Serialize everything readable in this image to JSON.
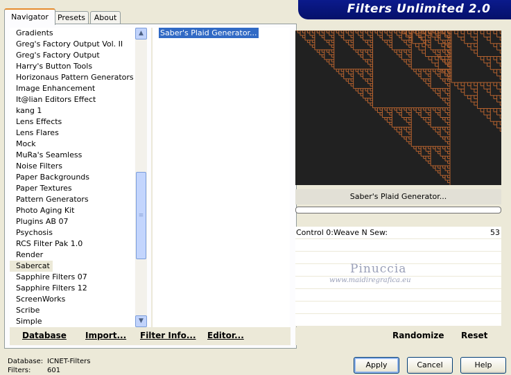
{
  "banner": {
    "title": "Filters Unlimited 2.0"
  },
  "tabs": [
    {
      "label": "Navigator",
      "active": true
    },
    {
      "label": "Presets",
      "active": false
    },
    {
      "label": "About",
      "active": false
    }
  ],
  "categories": [
    "Gradients",
    "Greg's Factory Output Vol. II",
    "Greg's Factory Output",
    "Harry's Button Tools",
    "Horizonaus Pattern Generators",
    "Image Enhancement",
    "It@lian Editors Effect",
    "kang 1",
    "Lens Effects",
    "Lens Flares",
    "Mock",
    "MuRa's Seamless",
    "Noise Filters",
    "Paper Backgrounds",
    "Paper Textures",
    "Pattern Generators",
    "Photo Aging Kit",
    "Plugins AB 07",
    "Psychosis",
    "RCS Filter Pak 1.0",
    "Render",
    "Sabercat",
    "Sapphire Filters 07",
    "Sapphire Filters 12",
    "ScreenWorks",
    "Scribe",
    "Simple"
  ],
  "selected_category": "Sabercat",
  "filters": [
    "Saber's Plaid Generator..."
  ],
  "nav_buttons": {
    "database": "Database",
    "import": "Import...",
    "filter_info": "Filter Info...",
    "editor": "Editor..."
  },
  "preview": {
    "filter_name": "Saber's Plaid Generator...",
    "background_color": "#212121",
    "pattern_color": "#b5622f"
  },
  "controls": [
    {
      "label": "Control 0:Weave N Sew:",
      "value": "53"
    }
  ],
  "watermark": {
    "line1": "Pinuccia",
    "line2": "www.maidiregrafica.eu"
  },
  "right_buttons": {
    "randomize": "Randomize",
    "reset": "Reset"
  },
  "status": {
    "database_label": "Database:",
    "database_value": "ICNET-Filters",
    "filters_label": "Filters:",
    "filters_value": "601"
  },
  "dialog_buttons": {
    "apply": "Apply",
    "cancel": "Cancel",
    "help": "Help"
  },
  "icons": {
    "scroll_up": "scroll-up-arrow-icon",
    "scroll_down": "scroll-down-arrow-icon",
    "grip": "scroll-grip-icon"
  },
  "accent_colors": {
    "banner": "#05106a",
    "selection": "#316ac5",
    "active_tab": "#e68b2c"
  }
}
